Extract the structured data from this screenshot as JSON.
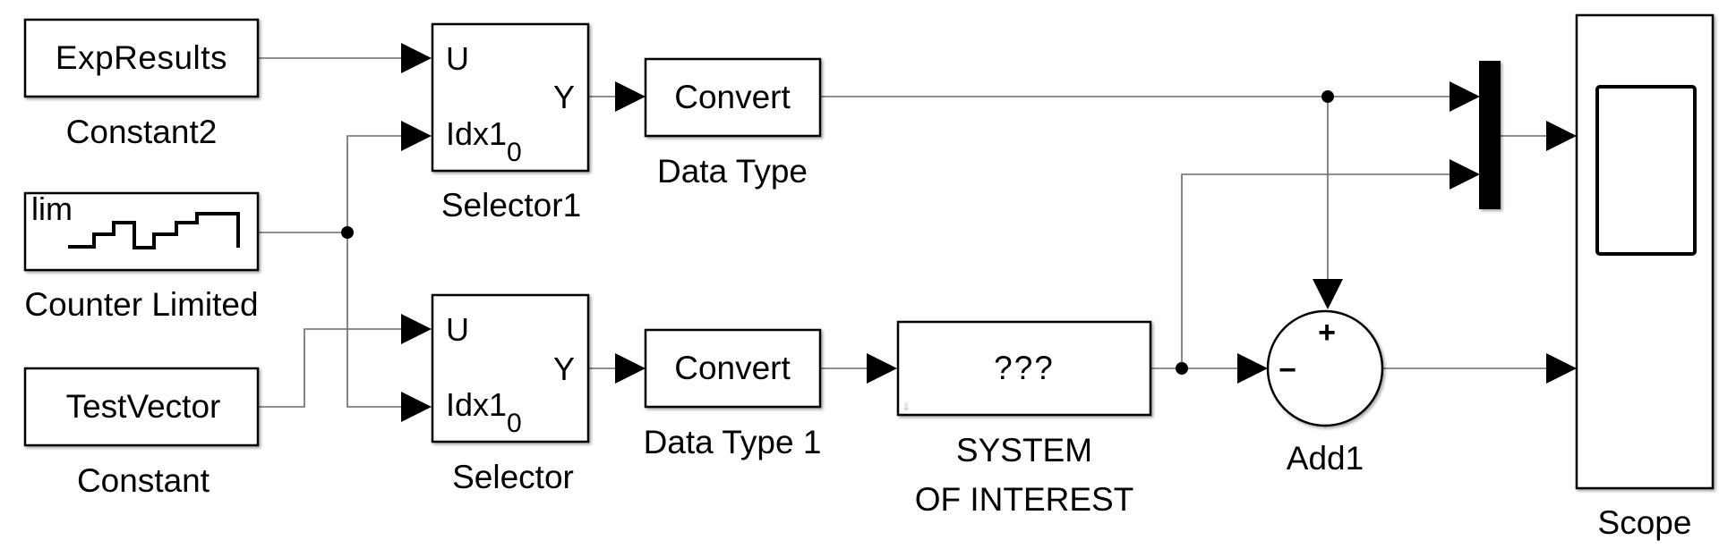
{
  "diagram": {
    "type": "simulink-model",
    "blocks": {
      "constant2": {
        "content": "ExpResults",
        "label": "Constant2"
      },
      "counter": {
        "content": "lim",
        "label": "Counter Limited"
      },
      "constant": {
        "content": "TestVector",
        "label": "Constant"
      },
      "selector1": {
        "port_u": "U",
        "port_idx": "Idx1",
        "port_idx_sub": "0",
        "port_y": "Y",
        "label": "Selector1"
      },
      "selector": {
        "port_u": "U",
        "port_idx": "Idx1",
        "port_idx_sub": "0",
        "port_y": "Y",
        "label": "Selector"
      },
      "convert1": {
        "content": "Convert",
        "label": "Data Type"
      },
      "convert2": {
        "content": "Convert",
        "label": "Data Type 1"
      },
      "system": {
        "content": "???",
        "label_line1": "SYSTEM",
        "label_line2": "OF INTEREST"
      },
      "add": {
        "sign_top": "+",
        "sign_left": "−",
        "label": "Add1"
      },
      "mux": {
        "label": ""
      },
      "scope": {
        "label": "Scope"
      }
    },
    "connections": [
      {
        "from": "Constant2",
        "to": "Selector1.U"
      },
      {
        "from": "Counter Limited",
        "to": "Selector1.Idx1"
      },
      {
        "from": "Counter Limited",
        "to": "Selector.Idx1"
      },
      {
        "from": "Constant",
        "to": "Selector.U"
      },
      {
        "from": "Selector1.Y",
        "to": "Data Type"
      },
      {
        "from": "Selector.Y",
        "to": "Data Type 1"
      },
      {
        "from": "Data Type",
        "to": "Mux.in1"
      },
      {
        "from": "Data Type",
        "to": "Add1.+"
      },
      {
        "from": "Data Type 1",
        "to": "SYSTEM OF INTEREST"
      },
      {
        "from": "SYSTEM OF INTEREST",
        "to": "Add1.-"
      },
      {
        "from": "SYSTEM OF INTEREST",
        "to": "Mux.in2"
      },
      {
        "from": "Mux",
        "to": "Scope.in1"
      },
      {
        "from": "Add1",
        "to": "Scope.in2"
      }
    ]
  }
}
